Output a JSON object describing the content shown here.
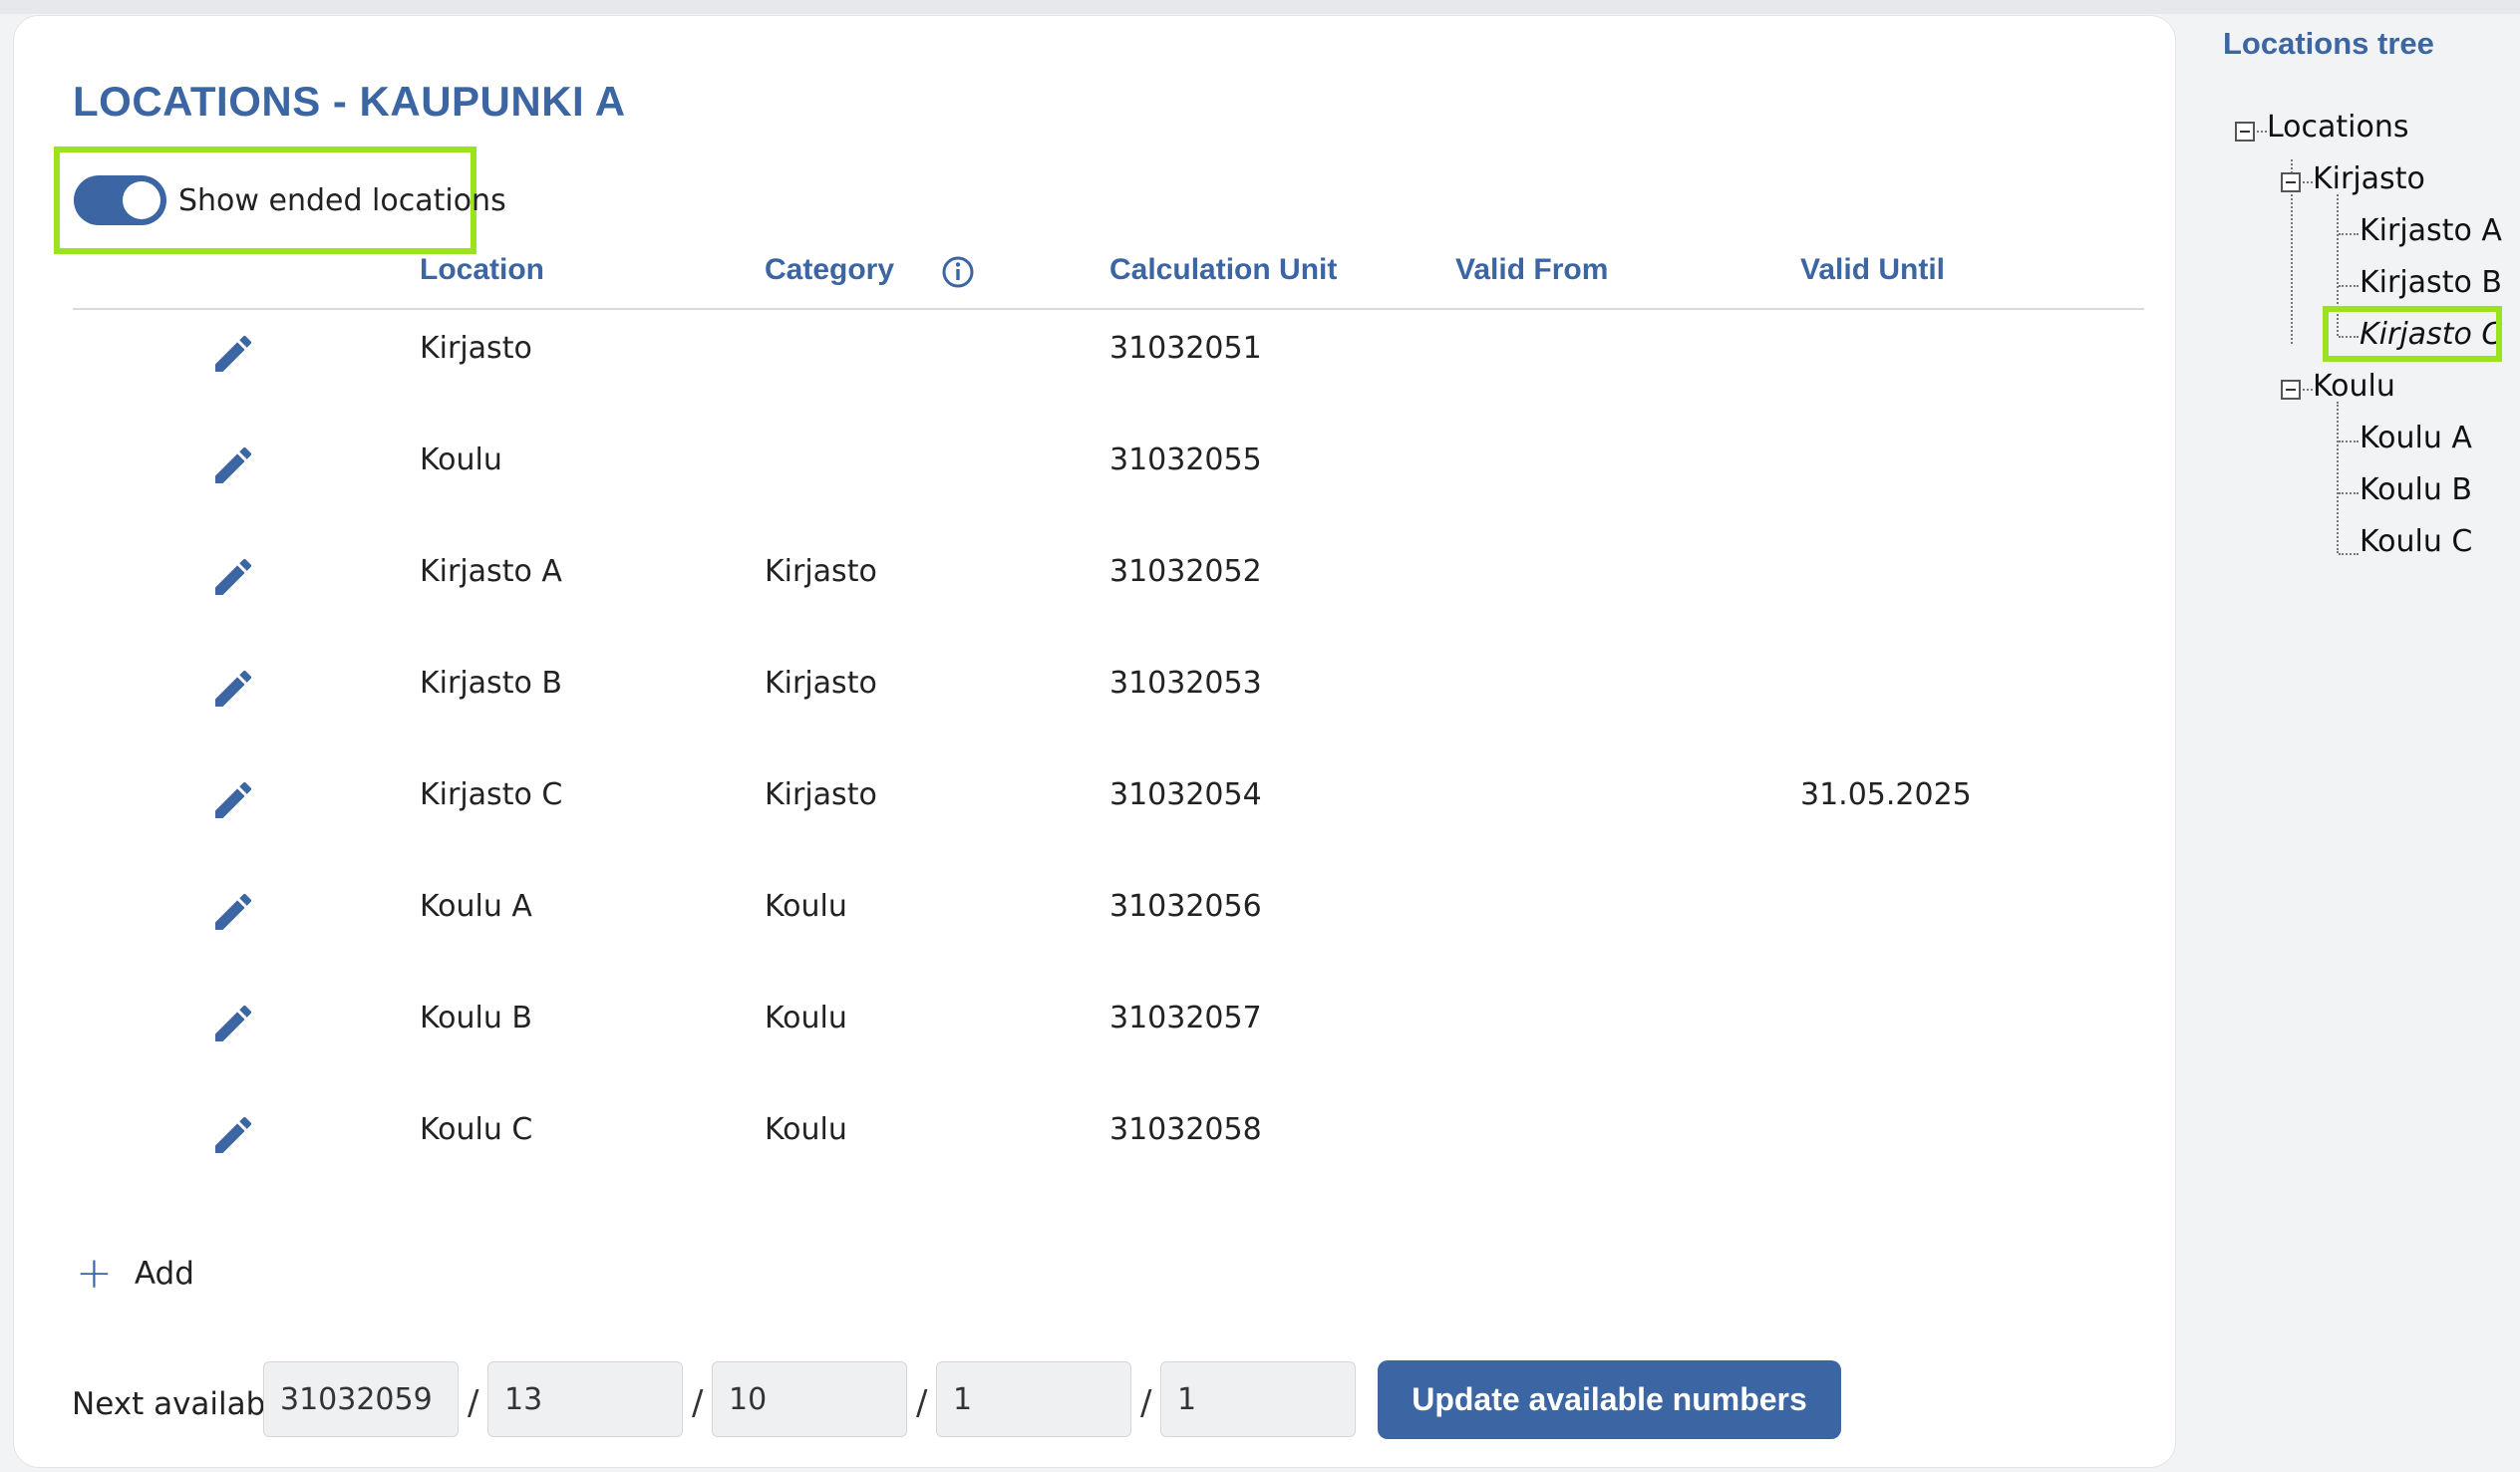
{
  "page": {
    "title": "LOCATIONS - KAUPUNKI A",
    "show_ended_label": "Show ended locations",
    "show_ended_on": true
  },
  "table": {
    "columns": [
      "Location",
      "Category",
      "Calculation Unit",
      "Valid From",
      "Valid Until"
    ],
    "rows": [
      {
        "location": "Kirjasto",
        "category": "",
        "unit": "31032051",
        "valid_from": "",
        "valid_until": ""
      },
      {
        "location": "Koulu",
        "category": "",
        "unit": "31032055",
        "valid_from": "",
        "valid_until": ""
      },
      {
        "location": "Kirjasto A",
        "category": "Kirjasto",
        "unit": "31032052",
        "valid_from": "",
        "valid_until": ""
      },
      {
        "location": "Kirjasto B",
        "category": "Kirjasto",
        "unit": "31032053",
        "valid_from": "",
        "valid_until": ""
      },
      {
        "location": "Kirjasto C",
        "category": "Kirjasto",
        "unit": "31032054",
        "valid_from": "",
        "valid_until": "31.05.2025"
      },
      {
        "location": "Koulu A",
        "category": "Koulu",
        "unit": "31032056",
        "valid_from": "",
        "valid_until": ""
      },
      {
        "location": "Koulu B",
        "category": "Koulu",
        "unit": "31032057",
        "valid_from": "",
        "valid_until": ""
      },
      {
        "location": "Koulu C",
        "category": "Koulu",
        "unit": "31032058",
        "valid_from": "",
        "valid_until": ""
      }
    ]
  },
  "actions": {
    "add_label": "Add"
  },
  "next_available": {
    "label": "Next available:",
    "values": [
      "31032059",
      "13",
      "10",
      "1",
      "1"
    ],
    "separator": "/",
    "update_label": "Update available numbers"
  },
  "tree": {
    "title": "Locations tree",
    "root": "Locations",
    "kirjasto": "Kirjasto",
    "kirjasto_children": [
      "Kirjasto A",
      "Kirjasto B",
      "Kirjasto C"
    ],
    "koulu": "Koulu",
    "koulu_children": [
      "Koulu A",
      "Koulu B",
      "Koulu C"
    ],
    "selected": "Kirjasto C"
  },
  "colors": {
    "accent": "#3b65a3",
    "highlight": "#9be21f"
  },
  "icons": {
    "edit": "pencil-icon",
    "info": "info-icon",
    "add": "plus-icon",
    "tree_expand": "minus-box-icon"
  }
}
